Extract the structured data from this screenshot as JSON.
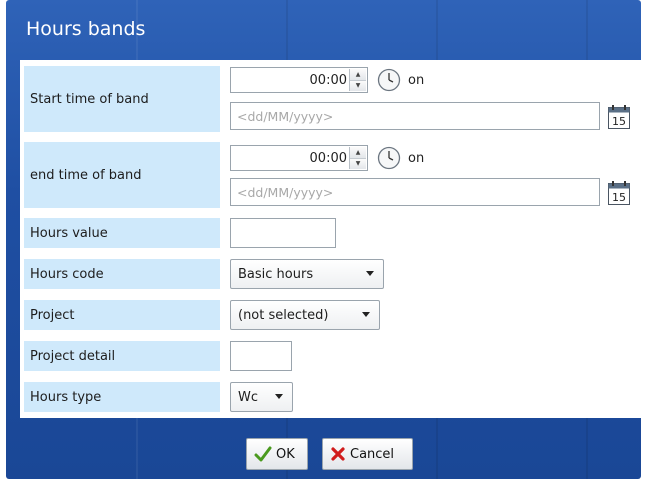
{
  "dialog": {
    "title": "Hours bands"
  },
  "start": {
    "label": "Start time of band",
    "time": "00:00",
    "on_text": "on",
    "date_placeholder": "<dd/MM/yyyy>",
    "calendar_day": "15"
  },
  "end": {
    "label": "end time of band",
    "time": "00:00",
    "on_text": "on",
    "date_placeholder": "<dd/MM/yyyy>",
    "calendar_day": "15"
  },
  "hours_value": {
    "label": "Hours value",
    "value": ""
  },
  "hours_code": {
    "label": "Hours code",
    "selected": "Basic hours"
  },
  "project": {
    "label": "Project",
    "selected": "(not selected)"
  },
  "project_detail": {
    "label": "Project detail",
    "value": ""
  },
  "hours_type": {
    "label": "Hours type",
    "selected": "Wc"
  },
  "buttons": {
    "ok": "OK",
    "cancel": "Cancel"
  },
  "colors": {
    "dialog_bg": "#1f4fa3",
    "label_bg": "#cfe9fb",
    "ok_check": "#4a9a1e",
    "cancel_x": "#d11c1c"
  }
}
